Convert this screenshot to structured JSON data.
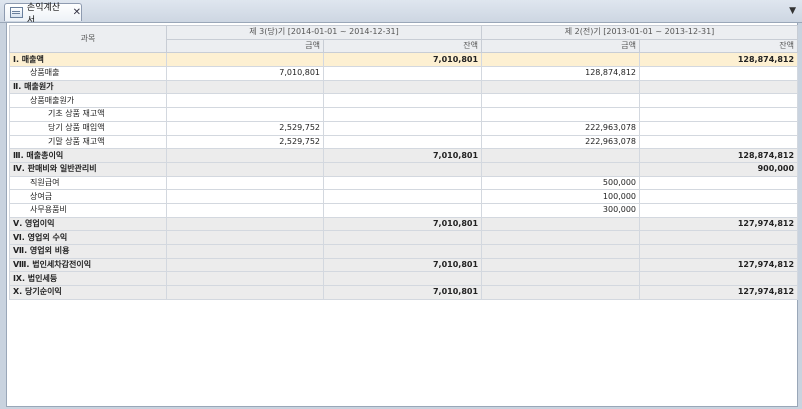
{
  "tab": {
    "title": "손익계산서",
    "close": "✕",
    "menu": "▼"
  },
  "header": {
    "subject": "과목",
    "period_current": "제 3(당)기 [2014-01-01 ~ 2014-12-31]",
    "period_previous": "제 2(전)기 [2013-01-01 ~ 2013-12-31]",
    "amount": "금액",
    "balance": "잔액"
  },
  "rows": [
    {
      "type": "highlight",
      "indent": 0,
      "label": "Ⅰ. 매출액",
      "c1": "",
      "c2": "7,010,801",
      "p1": "",
      "p2": "128,874,812"
    },
    {
      "type": "item",
      "indent": 1,
      "label": "상품매출",
      "c1": "7,010,801",
      "c2": "",
      "p1": "128,874,812",
      "p2": ""
    },
    {
      "type": "section",
      "indent": 0,
      "label": "Ⅱ. 매출원가",
      "c1": "",
      "c2": "",
      "p1": "",
      "p2": ""
    },
    {
      "type": "item",
      "indent": 1,
      "label": "상품매출원가",
      "c1": "",
      "c2": "",
      "p1": "",
      "p2": ""
    },
    {
      "type": "item",
      "indent": 2,
      "label": "기초 상품 재고액",
      "c1": "",
      "c2": "",
      "p1": "",
      "p2": ""
    },
    {
      "type": "item",
      "indent": 2,
      "label": "당기 상품 매입액",
      "c1": "2,529,752",
      "c2": "",
      "p1": "222,963,078",
      "p2": ""
    },
    {
      "type": "item",
      "indent": 2,
      "label": "기말 상품 재고액",
      "c1": "2,529,752",
      "c2": "",
      "p1": "222,963,078",
      "p2": ""
    },
    {
      "type": "section",
      "indent": 0,
      "label": "Ⅲ. 매출총이익",
      "c1": "",
      "c2": "7,010,801",
      "p1": "",
      "p2": "128,874,812"
    },
    {
      "type": "section",
      "indent": 0,
      "label": "Ⅳ. 판매비와 일반관리비",
      "c1": "",
      "c2": "",
      "p1": "",
      "p2": "900,000"
    },
    {
      "type": "item",
      "indent": 1,
      "label": "직원급여",
      "c1": "",
      "c2": "",
      "p1": "500,000",
      "p2": ""
    },
    {
      "type": "item",
      "indent": 1,
      "label": "상여금",
      "c1": "",
      "c2": "",
      "p1": "100,000",
      "p2": ""
    },
    {
      "type": "item",
      "indent": 1,
      "label": "사무용품비",
      "c1": "",
      "c2": "",
      "p1": "300,000",
      "p2": ""
    },
    {
      "type": "section",
      "indent": 0,
      "label": "Ⅴ. 영업이익",
      "c1": "",
      "c2": "7,010,801",
      "p1": "",
      "p2": "127,974,812"
    },
    {
      "type": "section",
      "indent": 0,
      "label": "Ⅵ. 영업외 수익",
      "c1": "",
      "c2": "",
      "p1": "",
      "p2": ""
    },
    {
      "type": "section",
      "indent": 0,
      "label": "Ⅶ. 영업외 비용",
      "c1": "",
      "c2": "",
      "p1": "",
      "p2": ""
    },
    {
      "type": "section",
      "indent": 0,
      "label": "Ⅷ. 법인세차감전이익",
      "c1": "",
      "c2": "7,010,801",
      "p1": "",
      "p2": "127,974,812"
    },
    {
      "type": "section",
      "indent": 0,
      "label": "Ⅸ. 법인세등",
      "c1": "",
      "c2": "",
      "p1": "",
      "p2": ""
    },
    {
      "type": "section",
      "indent": 0,
      "label": "Ⅹ. 당기순이익",
      "c1": "",
      "c2": "7,010,801",
      "p1": "",
      "p2": "127,974,812"
    }
  ]
}
